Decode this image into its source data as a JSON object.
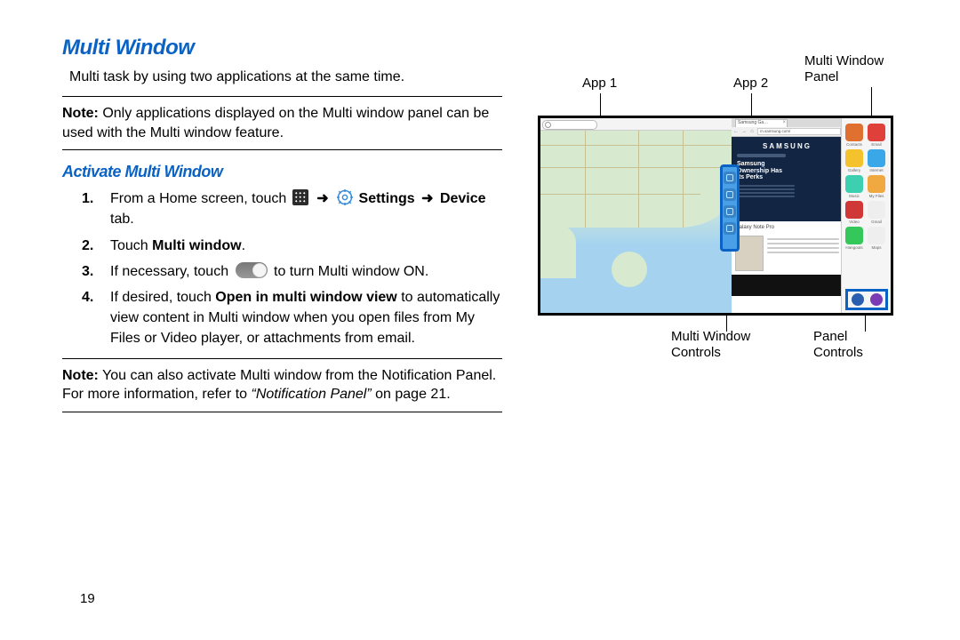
{
  "title": "Multi Window",
  "intro": "Multi task by using two applications at the same time.",
  "note1": {
    "label": "Note:",
    "text": " Only applications displayed on the Multi window panel can be used with the Multi window feature."
  },
  "subtitle": "Activate Multi Window",
  "steps": {
    "s1_a": "From a Home screen, touch ",
    "s1_b": " Settings ",
    "s1_c": "Device",
    "s1_d": " tab.",
    "s2_a": "Touch ",
    "s2_b": "Multi window",
    "s2_c": ".",
    "s3_a": "If necessary, touch ",
    "s3_b": " to turn Multi window ON.",
    "s4_a": "If desired, touch ",
    "s4_b": "Open in multi window view",
    "s4_c": " to automatically view content in Multi window when you open files from My Files or Video player, or attachments from email."
  },
  "note2": {
    "label": "Note:",
    "a": " You can also activate Multi window from the Notification Panel. For more information, refer to ",
    "ref": "“Notification Panel”",
    "b": " on page 21."
  },
  "page_number": "19",
  "callouts": {
    "app1": "App 1",
    "app2": "App 2",
    "mw_panel_a": "Multi Window",
    "mw_panel_b": "Panel",
    "mw_controls_a": "Multi Window",
    "mw_controls_b": "Controls",
    "panel_controls_a": "Panel",
    "panel_controls_b": "Controls"
  },
  "arrow": "➜",
  "diagram": {
    "tab_label": "Samsung Ga…",
    "url": "m.samsung.com/",
    "brand": "SAMSUNG",
    "hero_a": "Samsung",
    "hero_b": "Ownership Has",
    "hero_c": "Its Perks",
    "card_title": "Galaxy Note Pro",
    "panel_apps": [
      {
        "label": "Contacts",
        "color": "#e07030"
      },
      {
        "label": "Email",
        "color": "#e0403a"
      },
      {
        "label": "Gallery",
        "color": "#f3c22d"
      },
      {
        "label": "Internet",
        "color": "#3aa8e8"
      },
      {
        "label": "Music",
        "color": "#3ccfb0"
      },
      {
        "label": "My Files",
        "color": "#f0a840"
      },
      {
        "label": "Video",
        "color": "#d03838"
      },
      {
        "label": "Gmail",
        "color": "#eeeeee"
      },
      {
        "label": "Hangouts",
        "color": "#34c759"
      },
      {
        "label": "Maps",
        "color": "#eeeeee"
      }
    ]
  }
}
